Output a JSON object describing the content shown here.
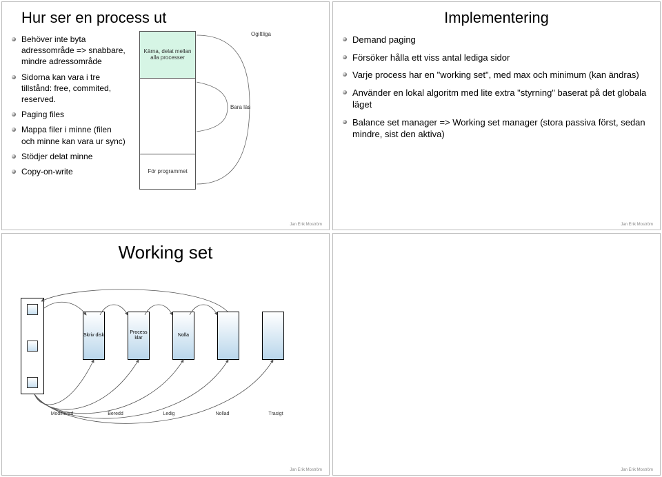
{
  "footer_author": "Jan Erik Moström",
  "slide1": {
    "title": "Hur ser en process ut",
    "bullets": [
      "Behöver inte byta adressområde => snabbare, mindre adressområde",
      "Sidorna kan vara i tre tillstånd: free, commited, reserved.",
      "Paging files",
      "Mappa filer i minne (filen och minne kan vara ur sync)",
      "Stödjer delat minne",
      "Copy-on-write"
    ],
    "diagram": {
      "seg1": "Kärna, delat mellan alla processer",
      "seg3": "För programmet",
      "callout_top": "Ogiltliga",
      "callout_mid": "Bara läs"
    }
  },
  "slide2": {
    "title": "Implementering",
    "bullets": [
      "Demand paging",
      "Försöker hålla ett viss antal lediga sidor",
      "Varje process har en \"working set\", med max och minimum (kan ändras)",
      "Använder en lokal algoritm med lite extra \"styrning\" baserat på det globala läget",
      "Balance set manager => Working set manager (stora passiva först, sedan mindre, sist den aktiva)"
    ]
  },
  "slide3": {
    "title": "Working set",
    "diagram": {
      "cols": [
        {
          "label": "Skriv disk"
        },
        {
          "label": "Process klar"
        },
        {
          "label": "Nolla"
        },
        {
          "label": ""
        },
        {
          "label": ""
        }
      ],
      "bottom_labels": [
        "Modifierad",
        "Beredd",
        "Ledig",
        "Nollad",
        "Trasigt"
      ]
    }
  }
}
